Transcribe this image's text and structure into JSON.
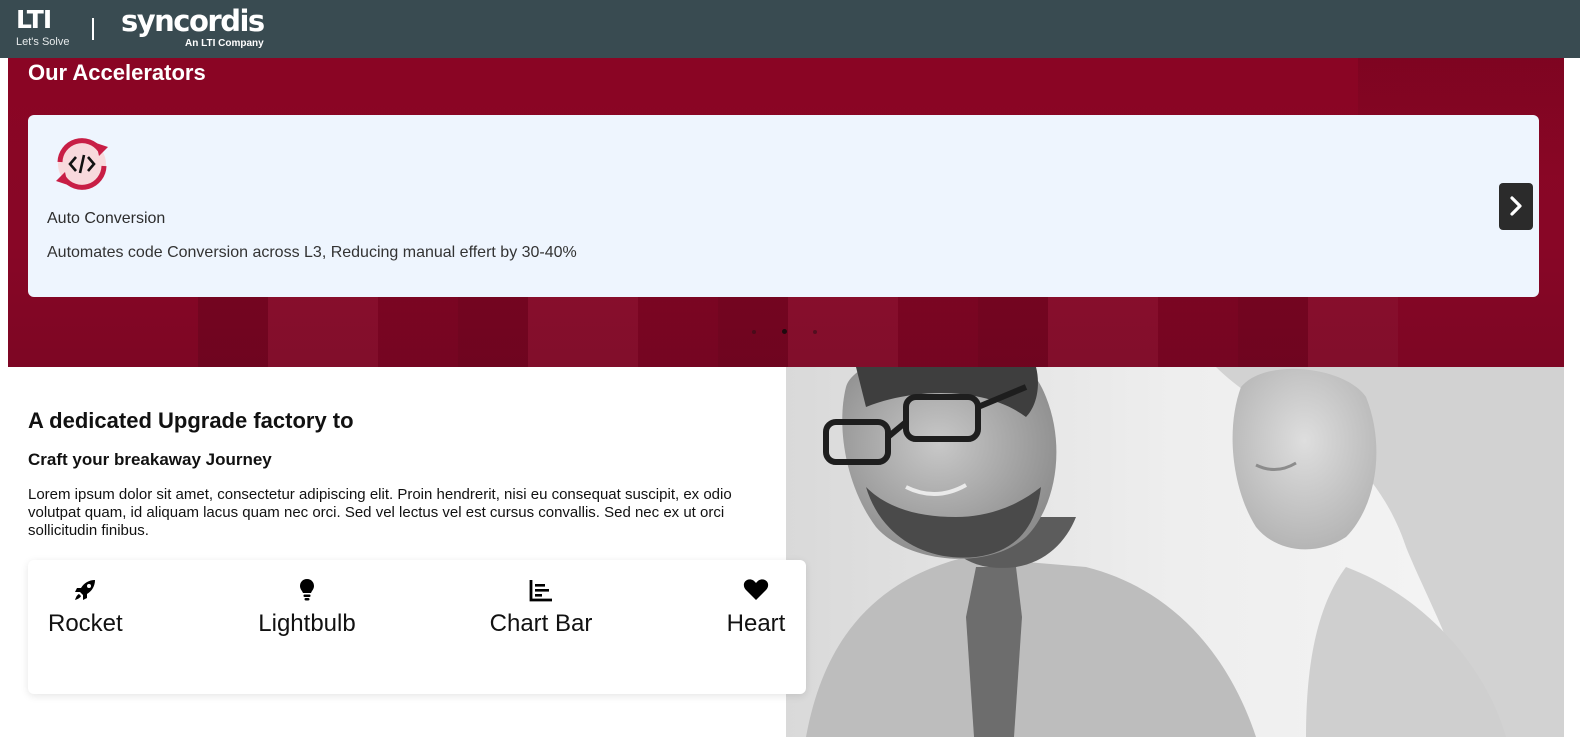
{
  "header": {
    "brand_primary": "LTI",
    "brand_primary_tagline": "Let's Solve",
    "brand_secondary": "syncordis",
    "brand_secondary_tagline": "An LTI Company"
  },
  "accelerators": {
    "title": "Our Accelerators",
    "card": {
      "icon": "code-convert-icon",
      "name": "Auto Conversion",
      "description": "Automates code Conversion across L3, Reducing manual effert by 30-40%"
    },
    "next_icon": "chevron-right-icon",
    "slides_total": 3,
    "active_slide": 2
  },
  "upgrade": {
    "title": "A dedicated Upgrade factory to",
    "subtitle": "Craft your breakaway Journey",
    "paragraph": "Lorem ipsum dolor sit amet, consectetur adipiscing elit. Proin hendrerit, nisi eu consequat suscipit, ex odio volutpat quam, id aliquam lacus quam nec orci. Sed vel lectus vel est cursus convallis. Sed nec ex ut orci sollicitudin finibus.",
    "features": [
      {
        "icon": "rocket-icon",
        "label": "Rocket"
      },
      {
        "icon": "lightbulb-icon",
        "label": "Lightbulb"
      },
      {
        "icon": "chart-bar-icon",
        "label": "Chart Bar"
      },
      {
        "icon": "heart-icon",
        "label": "Heart"
      }
    ]
  },
  "colors": {
    "header_bg": "#394b51",
    "hero_bg": "#8a0524",
    "card_bg": "#eef5fe",
    "icon_accent": "#c81e45"
  }
}
